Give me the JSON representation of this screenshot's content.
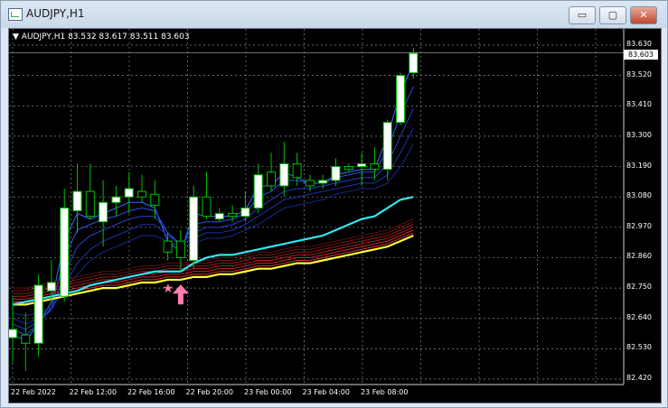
{
  "window": {
    "title": "AUDJPY,H1"
  },
  "controls": {
    "minimize": "▭",
    "maximize": "▢",
    "close": "✕"
  },
  "chart_header": "AUDJPY,H1  83.532 83.617 83.511 83.603",
  "current_price": "83.603",
  "price_ticks": [
    "83.630",
    "83.520",
    "83.410",
    "83.300",
    "83.190",
    "83.080",
    "82.970",
    "82.860",
    "82.750",
    "82.640",
    "82.530",
    "82.420"
  ],
  "time_ticks": [
    "22 Feb 2022",
    "22 Feb 12:00",
    "22 Feb 16:00",
    "22 Feb 20:00",
    "23 Feb 00:00",
    "23 Feb 04:00",
    "23 Feb 08:00"
  ],
  "colors": {
    "bull_body": "#ffffff",
    "bear_body": "#000000",
    "wick": "#00c000",
    "star": "#ff7fb0",
    "arrow": "#ff7fb0",
    "cyan": "#33e6f2",
    "yellow": "#ffff33",
    "red": "#c81e1e",
    "blue": "#2a3fd6"
  },
  "chart_data": {
    "type": "candlestick",
    "symbol": "AUDJPY",
    "timeframe": "H1",
    "ylim": [
      82.42,
      83.67
    ],
    "candles": [
      {
        "o": 82.57,
        "h": 82.72,
        "l": 82.48,
        "c": 82.6
      },
      {
        "o": 82.58,
        "h": 82.66,
        "l": 82.45,
        "c": 82.55
      },
      {
        "o": 82.55,
        "h": 82.8,
        "l": 82.5,
        "c": 82.76
      },
      {
        "o": 82.74,
        "h": 82.85,
        "l": 82.7,
        "c": 82.77
      },
      {
        "o": 82.72,
        "h": 83.11,
        "l": 82.7,
        "c": 83.04
      },
      {
        "o": 83.03,
        "h": 83.2,
        "l": 82.95,
        "c": 83.1
      },
      {
        "o": 83.1,
        "h": 83.2,
        "l": 83.0,
        "c": 83.01
      },
      {
        "o": 82.99,
        "h": 83.14,
        "l": 82.9,
        "c": 83.06
      },
      {
        "o": 83.06,
        "h": 83.12,
        "l": 83.01,
        "c": 83.08
      },
      {
        "o": 83.08,
        "h": 83.17,
        "l": 83.02,
        "c": 83.11
      },
      {
        "o": 83.1,
        "h": 83.16,
        "l": 83.06,
        "c": 83.08
      },
      {
        "o": 83.09,
        "h": 83.14,
        "l": 83.0,
        "c": 83.05
      },
      {
        "o": 82.92,
        "h": 82.95,
        "l": 82.85,
        "c": 82.88
      },
      {
        "o": 82.92,
        "h": 82.96,
        "l": 82.81,
        "c": 82.86
      },
      {
        "o": 82.85,
        "h": 83.12,
        "l": 82.82,
        "c": 83.08
      },
      {
        "o": 83.08,
        "h": 83.17,
        "l": 83.0,
        "c": 83.01
      },
      {
        "o": 83.0,
        "h": 83.04,
        "l": 82.99,
        "c": 83.02
      },
      {
        "o": 83.02,
        "h": 83.05,
        "l": 82.99,
        "c": 83.01
      },
      {
        "o": 83.01,
        "h": 83.1,
        "l": 82.99,
        "c": 83.04
      },
      {
        "o": 83.04,
        "h": 83.2,
        "l": 83.02,
        "c": 83.16
      },
      {
        "o": 83.17,
        "h": 83.24,
        "l": 83.1,
        "c": 83.12
      },
      {
        "o": 83.12,
        "h": 83.28,
        "l": 83.08,
        "c": 83.2
      },
      {
        "o": 83.2,
        "h": 83.24,
        "l": 83.12,
        "c": 83.15
      },
      {
        "o": 83.14,
        "h": 83.16,
        "l": 83.1,
        "c": 83.12
      },
      {
        "o": 83.13,
        "h": 83.16,
        "l": 83.11,
        "c": 83.14
      },
      {
        "o": 83.14,
        "h": 83.22,
        "l": 83.12,
        "c": 83.19
      },
      {
        "o": 83.19,
        "h": 83.2,
        "l": 83.17,
        "c": 83.18
      },
      {
        "o": 83.19,
        "h": 83.24,
        "l": 83.12,
        "c": 83.2
      },
      {
        "o": 83.2,
        "h": 83.26,
        "l": 83.14,
        "c": 83.18
      },
      {
        "o": 83.18,
        "h": 83.36,
        "l": 83.14,
        "c": 83.35
      },
      {
        "o": 83.35,
        "h": 83.53,
        "l": 83.34,
        "c": 83.52
      },
      {
        "o": 83.53,
        "h": 83.62,
        "l": 83.51,
        "c": 83.6
      }
    ],
    "ma_cyan": [
      82.69,
      82.7,
      82.71,
      82.72,
      82.73,
      82.74,
      82.76,
      82.77,
      82.78,
      82.79,
      82.8,
      82.81,
      82.81,
      82.81,
      82.84,
      82.86,
      82.87,
      82.87,
      82.88,
      82.89,
      82.9,
      82.91,
      82.92,
      82.93,
      82.94,
      82.96,
      82.98,
      83.0,
      83.01,
      83.04,
      83.07,
      83.08
    ],
    "ma_yellow": [
      82.69,
      82.69,
      82.7,
      82.71,
      82.72,
      82.73,
      82.74,
      82.75,
      82.75,
      82.76,
      82.77,
      82.77,
      82.78,
      82.78,
      82.79,
      82.79,
      82.8,
      82.8,
      82.81,
      82.82,
      82.82,
      82.83,
      82.84,
      82.84,
      82.85,
      82.86,
      82.87,
      82.88,
      82.89,
      82.9,
      82.92,
      82.94
    ],
    "red_band_offsets": [
      0.01,
      0.02,
      0.03,
      0.04,
      0.05,
      0.06
    ],
    "blue_band": [
      [
        82.58,
        82.56,
        82.62,
        82.7,
        82.92,
        83.02,
        83.0,
        83.02,
        83.04,
        83.06,
        83.06,
        83.04,
        82.92,
        82.88,
        83.02,
        83.01,
        83.01,
        83.01,
        83.03,
        83.12,
        83.12,
        83.17,
        83.15,
        83.13,
        83.13,
        83.16,
        83.17,
        83.18,
        83.18,
        83.3,
        83.46,
        83.56
      ],
      [
        82.6,
        82.58,
        82.62,
        82.68,
        82.86,
        82.96,
        82.98,
        83.0,
        83.01,
        83.03,
        83.04,
        83.03,
        82.95,
        82.9,
        82.98,
        82.99,
        82.99,
        83.0,
        83.02,
        83.08,
        83.1,
        83.14,
        83.14,
        83.13,
        83.13,
        83.15,
        83.16,
        83.17,
        83.17,
        83.25,
        83.38,
        83.48
      ],
      [
        82.62,
        82.6,
        82.63,
        82.67,
        82.8,
        82.9,
        82.94,
        82.96,
        82.98,
        83.0,
        83.01,
        83.01,
        82.95,
        82.91,
        82.95,
        82.97,
        82.97,
        82.98,
        83.0,
        83.04,
        83.07,
        83.1,
        83.11,
        83.11,
        83.12,
        83.13,
        83.14,
        83.15,
        83.15,
        83.2,
        83.3,
        83.4
      ],
      [
        82.64,
        82.62,
        82.64,
        82.67,
        82.76,
        82.84,
        82.89,
        82.92,
        82.94,
        82.96,
        82.98,
        82.98,
        82.94,
        82.91,
        82.93,
        82.95,
        82.95,
        82.96,
        82.98,
        83.01,
        83.04,
        83.07,
        83.08,
        83.09,
        83.1,
        83.11,
        83.12,
        83.13,
        83.13,
        83.16,
        83.24,
        83.33
      ],
      [
        82.66,
        82.65,
        82.66,
        82.68,
        82.74,
        82.8,
        82.85,
        82.88,
        82.9,
        82.92,
        82.94,
        82.94,
        82.92,
        82.9,
        82.91,
        82.93,
        82.93,
        82.94,
        82.96,
        82.98,
        83.01,
        83.04,
        83.05,
        83.06,
        83.07,
        83.09,
        83.1,
        83.11,
        83.11,
        83.13,
        83.19,
        83.27
      ]
    ],
    "markers": [
      {
        "type": "star",
        "index": 12,
        "price": 82.75
      },
      {
        "type": "arrow-up",
        "index": 13,
        "price": 82.73
      }
    ]
  }
}
